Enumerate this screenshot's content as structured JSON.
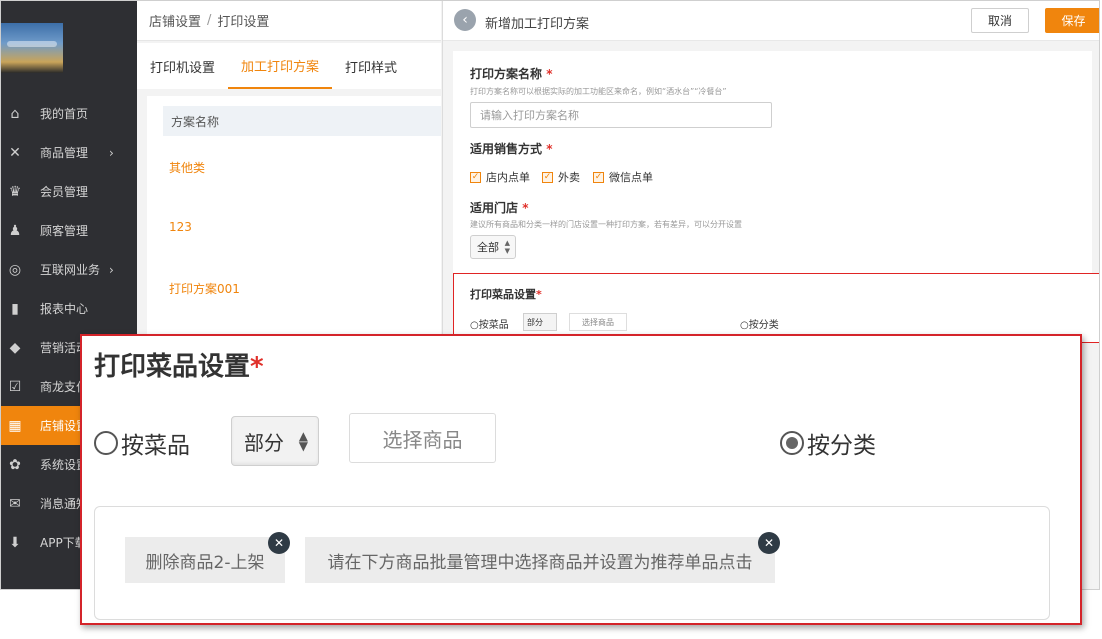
{
  "sidebar": {
    "items": [
      {
        "label": "我的首页",
        "icon": "home-icon",
        "glyph": "⌂"
      },
      {
        "label": "商品管理",
        "icon": "utensils-icon",
        "glyph": "✕",
        "arrow": "›"
      },
      {
        "label": "会员管理",
        "icon": "crown-icon",
        "glyph": "♛"
      },
      {
        "label": "顾客管理",
        "icon": "person-icon",
        "glyph": "♟"
      },
      {
        "label": "互联网业务",
        "icon": "planet-icon",
        "glyph": "◎",
        "arrow": "›"
      },
      {
        "label": "报表中心",
        "icon": "bar-chart-icon",
        "glyph": "▮"
      },
      {
        "label": "营销活动",
        "icon": "tag-icon",
        "glyph": "◆"
      },
      {
        "label": "商龙支付",
        "icon": "calendar-check-icon",
        "glyph": "☑"
      },
      {
        "label": "店铺设置",
        "icon": "store-icon",
        "glyph": "▦",
        "active": true
      },
      {
        "label": "系统设置",
        "icon": "gear-icon",
        "glyph": "✿"
      },
      {
        "label": "消息通知",
        "icon": "mail-icon",
        "glyph": "✉"
      },
      {
        "label": "APP下载",
        "icon": "download-icon",
        "glyph": "⬇"
      }
    ]
  },
  "breadcrumb": {
    "parent": "店铺设置",
    "separator": "/",
    "current": "打印设置"
  },
  "tabs": [
    {
      "label": "打印机设置"
    },
    {
      "label": "加工打印方案",
      "active": true
    },
    {
      "label": "打印样式"
    }
  ],
  "plan_list": {
    "header": "方案名称",
    "rows": [
      "其他类",
      "123",
      "打印方案001"
    ]
  },
  "panel": {
    "title": "新增加工打印方案",
    "cancel": "取消",
    "save": "保存",
    "name_label": "打印方案名称",
    "name_hint": "打印方案名称可以根据实际的加工功能区来命名，例如“酒水台”“冷餐台”",
    "name_placeholder": "请输入打印方案名称",
    "sale_label": "适用销售方式",
    "sale_options": [
      "店内点单",
      "外卖",
      "微信点单"
    ],
    "store_label": "适用门店",
    "store_hint": "建议所有商品和分类一样的门店设置一种打印方案，若有差异，可以分开设置",
    "store_value": "全部",
    "required_mark": "*"
  },
  "print_items": {
    "title": "打印菜品设置",
    "required_mark": "*",
    "by_item": "按菜品",
    "scope_value": "部分",
    "select_button": "选择商品",
    "by_category": "按分类",
    "selected_option": "by_category",
    "tags": [
      "删除商品2-上架",
      "请在下方商品批量管理中选择商品并设置为推荐单品点击"
    ]
  },
  "colors": {
    "accent": "#f0850d",
    "sidebar_bg": "#2e2f33",
    "callout_border": "#d4242a"
  }
}
